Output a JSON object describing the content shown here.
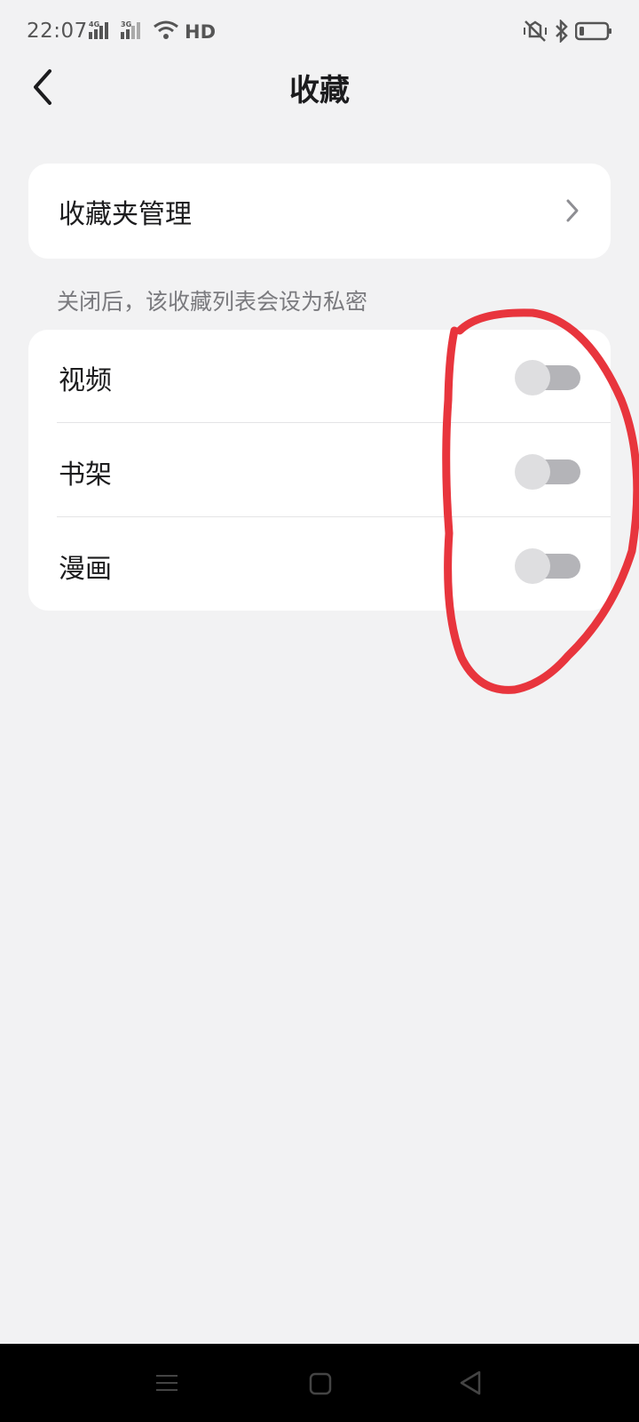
{
  "status_bar": {
    "time": "22:07",
    "network_1": "4G",
    "network_2": "3G",
    "hd_label": "HD",
    "icons": [
      "signal-icon",
      "wifi-icon",
      "mute-vibrate-icon",
      "bluetooth-icon",
      "battery-icon"
    ]
  },
  "header": {
    "title": "收藏",
    "back_icon": "back-arrow-icon"
  },
  "manage": {
    "label": "收藏夹管理",
    "chevron_icon": "chevron-right-icon"
  },
  "hint": "关闭后，该收藏列表会设为私密",
  "toggles": [
    {
      "label": "视频",
      "enabled": false
    },
    {
      "label": "书架",
      "enabled": false
    },
    {
      "label": "漫画",
      "enabled": false
    }
  ],
  "nav_bar": {
    "icons": [
      "menu-icon",
      "home-icon",
      "back-icon"
    ]
  },
  "colors": {
    "background": "#f2f2f3",
    "card": "#ffffff",
    "switch_track_off": "#b4b4b8",
    "switch_knob_off": "#dedee0",
    "annotation": "#e8353d"
  }
}
